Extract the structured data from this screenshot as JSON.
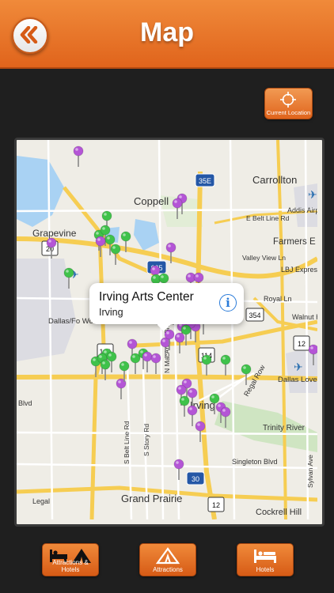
{
  "header": {
    "title": "Map",
    "back_icon": "double-chevron-left-icon"
  },
  "toolbar": {
    "current_location_label": "Current Location",
    "current_location_icon": "crosshair-icon"
  },
  "map": {
    "labels": {
      "carrollton": "Carrollton",
      "coppell": "Coppell",
      "grapevine": "Grapevine",
      "addison_airport": "Addis Airport",
      "e_belt_line": "E Belt Line Rd",
      "farmers": "Farmers E",
      "valley_view": "Valley View Ln",
      "lbj": "LBJ Express",
      "royal": "Royal Ln",
      "walnut": "Walnut Hill Ln",
      "dallas_fw": "Dallas/Fo Worth International Airport (DFW)",
      "irving": "Irving",
      "dallas_love": "Dallas Love Field (DAL)",
      "regal_row": "Regal Row",
      "trinity": "Trinity River",
      "singleton": "Singleton Blvd",
      "grand_prairie": "Grand Prairie",
      "cockrell": "Cockrell Hill",
      "legal": "Legal",
      "n_macarthur": "N MacArthur Blvd",
      "s_belt_line": "S Belt Line Rd",
      "s_story": "S Story Rd",
      "sylvan": "Sylvan Ave",
      "blvd": "Blvd"
    },
    "shields": [
      "35E",
      "635",
      "354",
      "12",
      "114",
      "161",
      "30",
      "12",
      "20"
    ],
    "callout": {
      "title": "Irving Arts Center",
      "subtitle": "Irving",
      "info_icon": "info-icon"
    },
    "pin_colors": {
      "attraction": "#b455d6",
      "hotel": "#3fc24a"
    }
  },
  "tabs": [
    {
      "label": "Attractions & Hotels",
      "icon": "bed-and-tent-icon"
    },
    {
      "label": "Attractions",
      "icon": "tent-icon"
    },
    {
      "label": "Hotels",
      "icon": "bed-icon"
    }
  ]
}
